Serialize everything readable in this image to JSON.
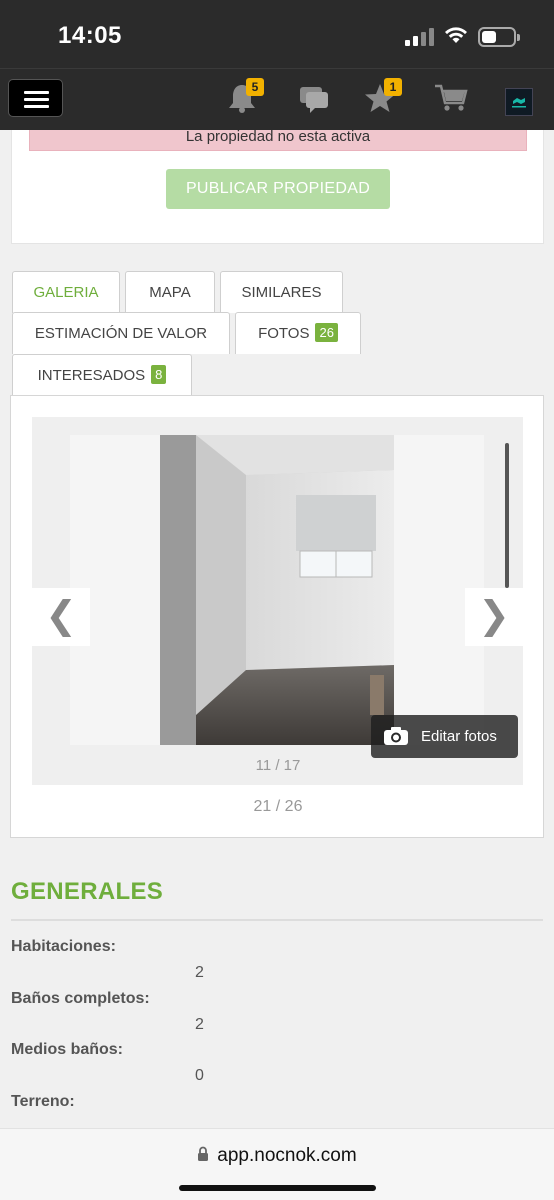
{
  "status_bar": {
    "time": "14:05"
  },
  "nav": {
    "notifications_count": "5",
    "favorites_count": "1"
  },
  "property": {
    "inactive_notice": "La propiedad no esta activa",
    "publish_button": "PUBLICAR PROPIEDAD"
  },
  "tabs": [
    {
      "label": "GALERIA",
      "badge": ""
    },
    {
      "label": "MAPA",
      "badge": ""
    },
    {
      "label": "SIMILARES",
      "badge": ""
    },
    {
      "label": "ESTIMACIÓN DE VALOR",
      "badge": ""
    },
    {
      "label": "FOTOS",
      "badge": "26"
    },
    {
      "label": "INTERESADOS",
      "badge": "8"
    }
  ],
  "gallery": {
    "prev_arrow": "❮",
    "next_arrow": "❯",
    "edit_photos_label": "Editar fotos",
    "inner_counter": "11 / 17",
    "outer_counter": "21 / 26"
  },
  "generales": {
    "title": "GENERALES",
    "rows": [
      {
        "label": "Habitaciones:",
        "value": "2"
      },
      {
        "label": "Baños completos:",
        "value": "2"
      },
      {
        "label": "Medios baños:",
        "value": "0"
      },
      {
        "label": "Terreno:",
        "value": ""
      }
    ]
  },
  "browser": {
    "url": "app.nocnok.com"
  },
  "colors": {
    "accent_green": "#6fae3c",
    "badge_yellow": "#f2b100",
    "alert_pink": "#f0c6cd",
    "publish_green": "#b5dca4"
  }
}
